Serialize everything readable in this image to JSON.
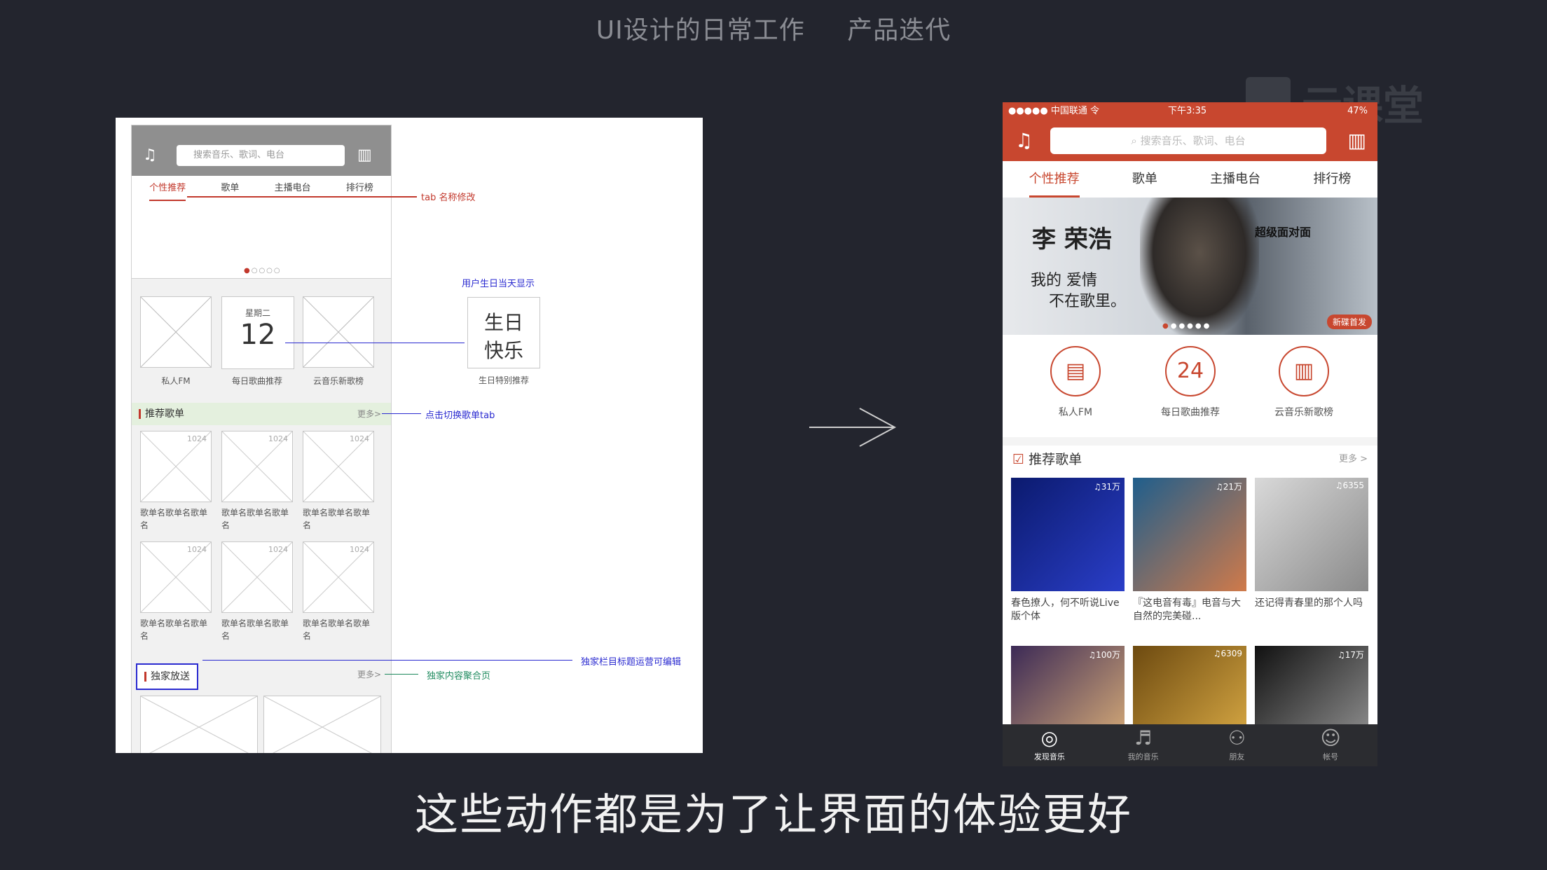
{
  "header": {
    "title_left": "UI设计的日常工作",
    "title_right": "产品迭代"
  },
  "subtitle": "这些动作都是为了让界面的体验更好",
  "watermark": "云课堂",
  "wireframe": {
    "search_placeholder": "搜索音乐、歌词、电台",
    "tabs": [
      "个性推荐",
      "歌单",
      "主播电台",
      "排行榜"
    ],
    "quick_labels": [
      "私人FM",
      "每日歌曲推荐",
      "云音乐新歌榜"
    ],
    "date_weekday": "星期二",
    "date_number": "12",
    "birthday_line1": "生日",
    "birthday_line2": "快乐",
    "birthday_label": "生日特别推荐",
    "section1_title": "推荐歌单",
    "section2_title": "独家放送",
    "more": "更多>",
    "count": "1024",
    "cell_label_a": "歌单名歌单名歌单名",
    "cell_label_b": "歌单名歌单名歌单名",
    "annot_tab": "tab 名称修改",
    "annot_birthday": "用户生日当天显示",
    "annot_switch": "点击切换歌单tab",
    "annot_edit": "独家栏目标题运营可编辑",
    "annot_all": "独家内容聚合页"
  },
  "phone": {
    "status_left": "●●●●● 中国联通 令",
    "status_time": "下午3:35",
    "status_right": "47%",
    "search_placeholder": "搜索音乐、歌词、电台",
    "tabs": [
      "个性推荐",
      "歌单",
      "主播电台",
      "排行榜"
    ],
    "banner_name": "李 荣浩",
    "banner_line1": "我的  爱情",
    "banner_line2": "不在歌里。",
    "banner_tag": "超级面对面",
    "banner_badge": "新碟首发",
    "quick": [
      {
        "icon": "radio-icon",
        "glyph": "▤",
        "label": "私人FM"
      },
      {
        "icon": "calendar-icon",
        "glyph": "24",
        "label": "每日歌曲推荐"
      },
      {
        "icon": "chart-icon",
        "glyph": "▥",
        "label": "云音乐新歌榜"
      }
    ],
    "section_title": "推荐歌单",
    "more": "更多 >",
    "playlists": [
      {
        "count": "♫31万",
        "title": "春色撩人，何不听说Live版个体",
        "c1": "#0b1a6e",
        "c2": "#2a3ec8"
      },
      {
        "count": "♫21万",
        "title": "『这电音有毒』电音与大自然的完美碰...",
        "c1": "#1f5e8c",
        "c2": "#d07a4a"
      },
      {
        "count": "♫6355",
        "title": "还记得青春里的那个人吗",
        "c1": "#d9d9d9",
        "c2": "#8a8a8a"
      }
    ],
    "playlists_row2": [
      {
        "count": "♫100万",
        "c1": "#3c2a56",
        "c2": "#e2b57a"
      },
      {
        "count": "♫6309",
        "c1": "#6d4a10",
        "c2": "#e0b048"
      },
      {
        "count": "♫17万",
        "c1": "#111111",
        "c2": "#9a9a9a"
      }
    ],
    "tabbar": [
      {
        "icon": "discover-icon",
        "glyph": "◎",
        "label": "发现音乐"
      },
      {
        "icon": "music-note-icon",
        "glyph": "♬",
        "label": "我的音乐"
      },
      {
        "icon": "friends-icon",
        "glyph": "⚇",
        "label": "朋友"
      },
      {
        "icon": "account-icon",
        "glyph": "☺",
        "label": "帐号"
      }
    ]
  },
  "colors": {
    "background": "#23252e",
    "accent": "#c8472f",
    "annot_blue": "#2a2ad0",
    "annot_green": "#1e8a5e"
  }
}
